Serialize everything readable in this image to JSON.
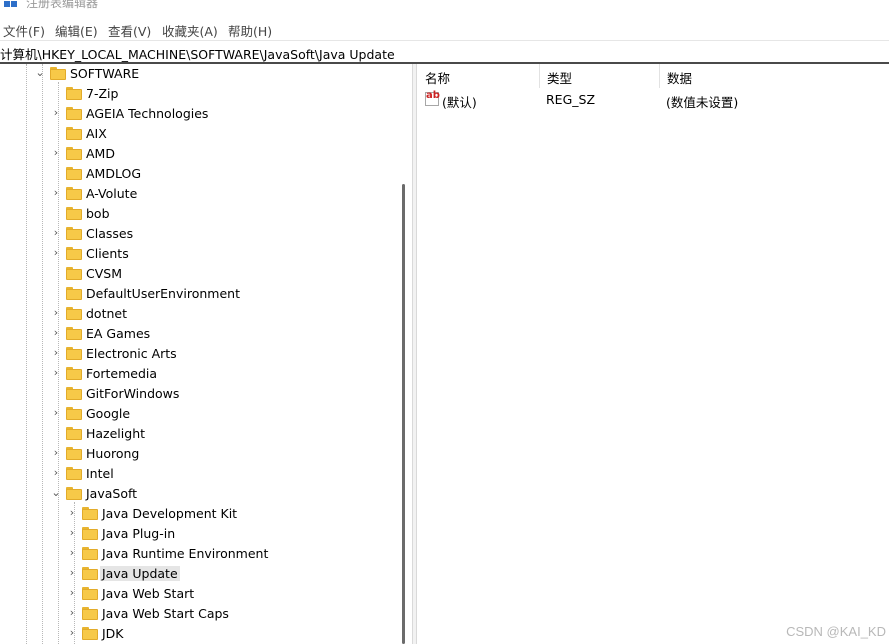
{
  "window": {
    "title": "注册表编辑器"
  },
  "menu": [
    "文件(F)",
    "编辑(E)",
    "查看(V)",
    "收藏夹(A)",
    "帮助(H)"
  ],
  "address": "计算机\\HKEY_LOCAL_MACHINE\\SOFTWARE\\JavaSoft\\Java Update",
  "tree": {
    "root": {
      "label": "SOFTWARE",
      "expanded": true
    },
    "children": [
      {
        "label": "7-Zip",
        "expandable": false
      },
      {
        "label": "AGEIA Technologies",
        "expandable": true
      },
      {
        "label": "AIX",
        "expandable": false
      },
      {
        "label": "AMD",
        "expandable": true
      },
      {
        "label": "AMDLOG",
        "expandable": false
      },
      {
        "label": "A-Volute",
        "expandable": true
      },
      {
        "label": "bob",
        "expandable": false
      },
      {
        "label": "Classes",
        "expandable": true
      },
      {
        "label": "Clients",
        "expandable": true
      },
      {
        "label": "CVSM",
        "expandable": false
      },
      {
        "label": "DefaultUserEnvironment",
        "expandable": false
      },
      {
        "label": "dotnet",
        "expandable": true
      },
      {
        "label": "EA Games",
        "expandable": true
      },
      {
        "label": "Electronic Arts",
        "expandable": true
      },
      {
        "label": "Fortemedia",
        "expandable": true
      },
      {
        "label": "GitForWindows",
        "expandable": false
      },
      {
        "label": "Google",
        "expandable": true
      },
      {
        "label": "Hazelight",
        "expandable": false
      },
      {
        "label": "Huorong",
        "expandable": true
      },
      {
        "label": "Intel",
        "expandable": true
      },
      {
        "label": "JavaSoft",
        "expandable": true,
        "expanded": true
      }
    ],
    "javasoft_children": [
      {
        "label": "Java Development Kit",
        "selected": false
      },
      {
        "label": "Java Plug-in",
        "selected": false
      },
      {
        "label": "Java Runtime Environment",
        "selected": false
      },
      {
        "label": "Java Update",
        "selected": true
      },
      {
        "label": "Java Web Start",
        "selected": false
      },
      {
        "label": "Java Web Start Caps",
        "selected": false
      },
      {
        "label": "JDK",
        "selected": false
      }
    ]
  },
  "values": {
    "columns": [
      "名称",
      "类型",
      "数据"
    ],
    "rows": [
      {
        "icon": "ab-string-icon",
        "name": "(默认)",
        "type": "REG_SZ",
        "data": "(数值未设置)"
      }
    ]
  },
  "watermark": "CSDN @KAI_KD",
  "colors": {
    "folder": "#f7c948",
    "selection": "#e5e5e5",
    "accent": "#2d6fc9"
  }
}
